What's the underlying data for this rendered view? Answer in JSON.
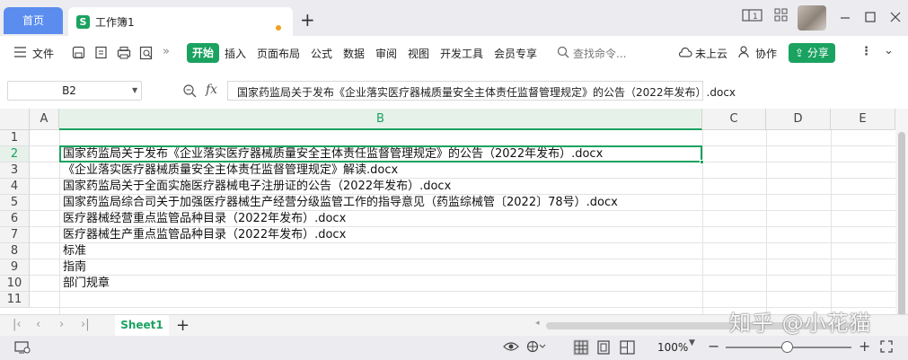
{
  "titlebar": {
    "home_tab": "首页",
    "doc_tab": "工作簿1",
    "new_tab": "+"
  },
  "menubar": {
    "file": "文件",
    "start": "开始",
    "insert": "插入",
    "layout": "页面布局",
    "formula": "公式",
    "data": "数据",
    "review": "审阅",
    "view": "视图",
    "devtools": "开发工具",
    "member": "会员专享",
    "search_placeholder": "查找命令...",
    "cloud": "未上云",
    "collab": "协作",
    "share": "分享"
  },
  "formulabar": {
    "cell_ref": "B2",
    "fx": "fx",
    "formula": "国家药监局关于发布《企业落实医疗器械质量安全主体责任监督管理规定》的公告（2022年发布）.docx"
  },
  "grid": {
    "columns": [
      "A",
      "B",
      "C",
      "D",
      "E"
    ],
    "active_column": "B",
    "active_row": "2",
    "rows": [
      {
        "num": "1",
        "b": ""
      },
      {
        "num": "2",
        "b": "国家药监局关于发布《企业落实医疗器械质量安全主体责任监督管理规定》的公告（2022年发布）.docx"
      },
      {
        "num": "3",
        "b": "《企业落实医疗器械质量安全主体责任监督管理规定》解读.docx"
      },
      {
        "num": "4",
        "b": "国家药监局关于全面实施医疗器械电子注册证的公告（2022年发布）.docx"
      },
      {
        "num": "5",
        "b": "国家药监局综合司关于加强医疗器械生产经营分级监管工作的指导意见（药监综械管〔2022〕78号）.docx"
      },
      {
        "num": "6",
        "b": "医疗器械经营重点监管品种目录（2022年发布）.docx"
      },
      {
        "num": "7",
        "b": "医疗器械生产重点监管品种目录（2022年发布）.docx"
      },
      {
        "num": "8",
        "b": "标准"
      },
      {
        "num": "9",
        "b": "指南"
      },
      {
        "num": "10",
        "b": "部门规章"
      },
      {
        "num": "11",
        "b": ""
      }
    ]
  },
  "sheetbar": {
    "sheet1": "Sheet1",
    "add": "+"
  },
  "watermark": "知乎 @小花猫",
  "statusbar": {
    "zoom": "100%"
  },
  "colors": {
    "accent": "#1aa260",
    "home_tab": "#5b8def"
  }
}
